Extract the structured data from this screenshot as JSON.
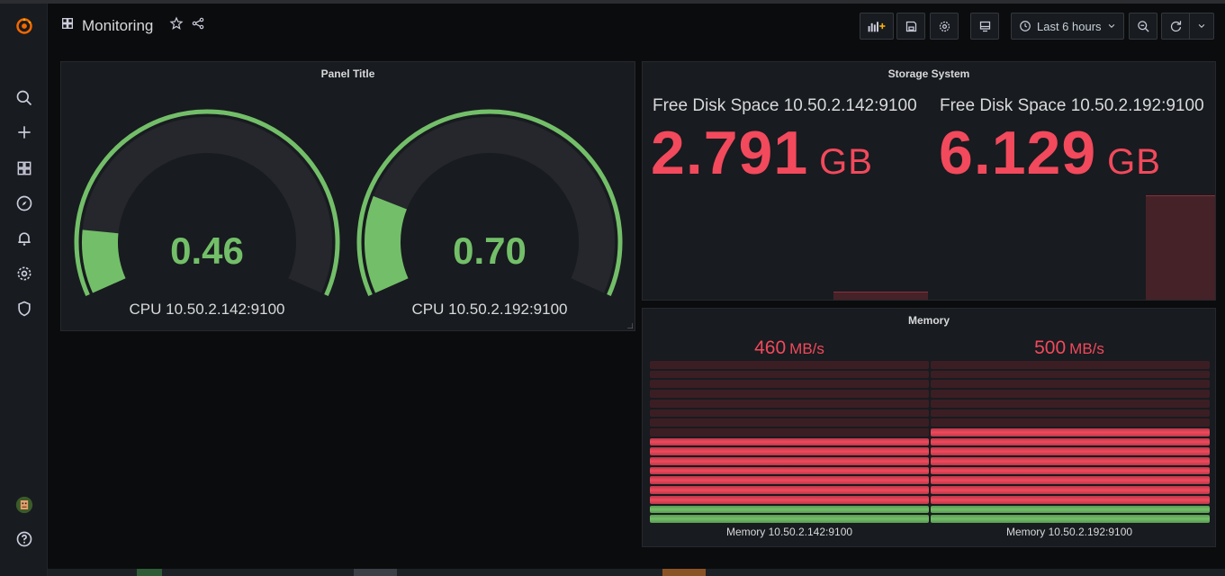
{
  "dashboard": {
    "title": "Monitoring"
  },
  "toolbar": {
    "time_range": "Last 6 hours"
  },
  "colors": {
    "green": "#73bf69",
    "red": "#f2495c",
    "dark_red": "#452228",
    "accent": "#f46800"
  },
  "icons": {
    "sidebar": [
      "grafana-logo-icon",
      "search-icon",
      "plus-icon",
      "dashboards-icon",
      "explore-icon",
      "bell-icon",
      "gear-icon",
      "shield-icon",
      "avatar",
      "help-icon"
    ],
    "toolbar": [
      "add-panel-icon",
      "save-icon",
      "settings-icon",
      "tv-mode-icon",
      "clock-icon",
      "zoom-out-icon",
      "refresh-icon",
      "chevron-down-icon"
    ]
  },
  "panels": {
    "cpu": {
      "title": "Panel Title",
      "gauges": [
        {
          "label": "CPU 10.50.2.142:9100",
          "value": "0.46",
          "fraction": 0.13
        },
        {
          "label": "CPU 10.50.2.192:9100",
          "value": "0.70",
          "fraction": 0.2
        }
      ]
    },
    "storage": {
      "title": "Storage System",
      "stats": [
        {
          "label": "Free Disk Space 10.50.2.142:9100",
          "value": "2.791",
          "unit": "GB"
        },
        {
          "label": "Free Disk Space 10.50.2.192:9100",
          "value": "6.129",
          "unit": "GB"
        }
      ]
    },
    "memory": {
      "title": "Memory",
      "bars": [
        {
          "label": "Memory 10.50.2.142:9100",
          "value": "460",
          "unit": "MB/s",
          "lit_red": 7,
          "lit_green": 2,
          "total": 17
        },
        {
          "label": "Memory 10.50.2.192:9100",
          "value": "500",
          "unit": "MB/s",
          "lit_red": 8,
          "lit_green": 2,
          "total": 17
        }
      ]
    }
  }
}
